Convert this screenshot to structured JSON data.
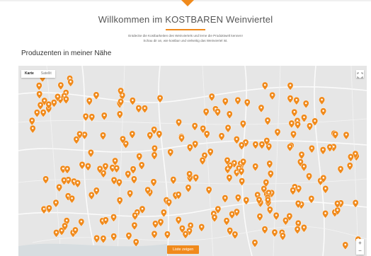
{
  "header": {
    "title": "Willkommen im KOSTBAREN Weinviertel",
    "intro_line1": "Entdecke die Kostbarkeiten des Weinviertels und lerne die Produktwelt kennen!",
    "intro_line2": "Schau dir an, wie kostbar und vielseitig das Weinviertel ist."
  },
  "section": {
    "heading": "Produzenten in meiner Nähe"
  },
  "map": {
    "type_tabs": [
      "Karte",
      "Satellit"
    ],
    "selected_tab": "Karte",
    "list_button": "Liste zeigen",
    "zoom_in": "+",
    "zoom_out": "−",
    "marker_color": "#f08a1c"
  },
  "colors": {
    "accent": "#f08a1c"
  }
}
